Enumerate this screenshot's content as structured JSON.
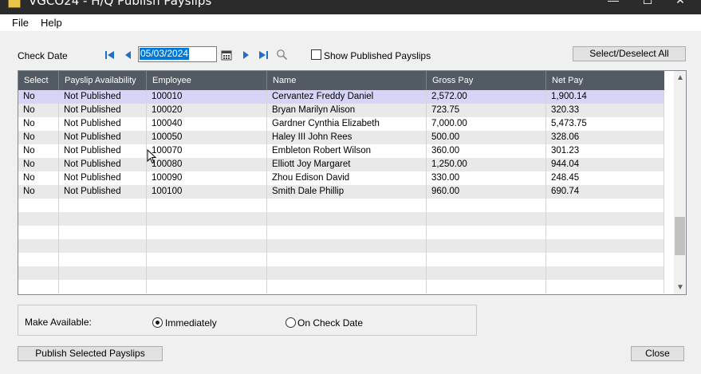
{
  "window": {
    "title": "VGCO24 - H/Q Publish Payslips",
    "controls": [
      "—",
      "☐",
      "✕"
    ]
  },
  "menu": [
    "File",
    "Help"
  ],
  "toolbar": {
    "check_date_label": "Check Date",
    "check_date_value": "05/03/2024",
    "show_published_label": "Show Published Payslips",
    "show_published_checked": false,
    "select_deselect_label": "Select/Deselect All"
  },
  "grid": {
    "columns": [
      "Select",
      "Payslip Availability",
      "Employee",
      "Name",
      "Gross Pay",
      "Net Pay"
    ],
    "rows": [
      [
        "No",
        "Not Published",
        "100010",
        "Cervantez Freddy Daniel",
        "2,572.00",
        "1,900.14"
      ],
      [
        "No",
        "Not Published",
        "100020",
        "Bryan Marilyn Alison",
        "723.75",
        "320.33"
      ],
      [
        "No",
        "Not Published",
        "100040",
        "Gardner Cynthia Elizabeth",
        "7,000.00",
        "5,473.75"
      ],
      [
        "No",
        "Not Published",
        "100050",
        "Haley III John Rees",
        "500.00",
        "328.06"
      ],
      [
        "No",
        "Not Published",
        "100070",
        "Embleton Robert Wilson",
        "360.00",
        "301.23"
      ],
      [
        "No",
        "Not Published",
        "100080",
        "Elliott Joy Margaret",
        "1,250.00",
        "944.04"
      ],
      [
        "No",
        "Not Published",
        "100090",
        "Zhou Edison David",
        "330.00",
        "248.45"
      ],
      [
        "No",
        "Not Published",
        "100100",
        "Smith Dale Phillip",
        "960.00",
        "690.74"
      ]
    ],
    "selected_row_index": 0
  },
  "make_available": {
    "label": "Make Available:",
    "options": [
      "Immediately",
      "On Check Date"
    ],
    "selected": "Immediately"
  },
  "footer": {
    "publish_label": "Publish Selected Payslips",
    "close_label": "Close"
  },
  "colors": {
    "header_bg": "#525a63",
    "selected_row": "#d8d4f8",
    "accent": "#0078d7"
  }
}
